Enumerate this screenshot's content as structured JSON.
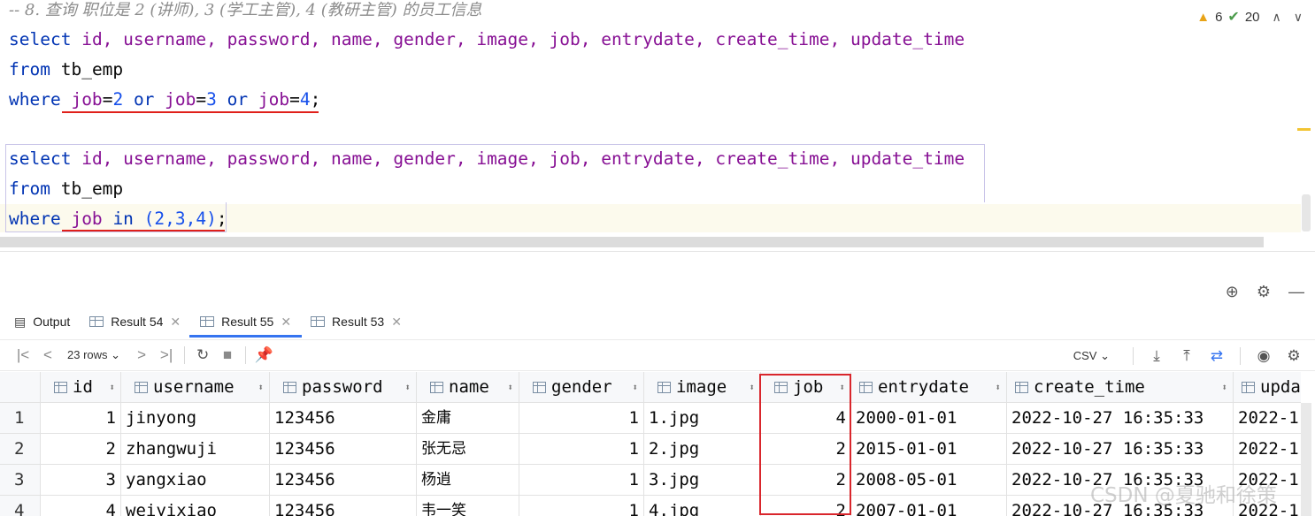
{
  "editor": {
    "comment": "-- 8. 查询 职位是 2 (讲师), 3 (学工主管), 4 (教研主管) 的员工信息",
    "query1": {
      "select_kw": "select",
      "columns": "id, username, password, name, gender, image, job, entrydate, create_time, update_time",
      "from_kw": "from",
      "table": "tb_emp",
      "where_kw": "where",
      "cond": [
        {
          "col": "job",
          "op": "=",
          "val": "2"
        },
        {
          "kw": "or"
        },
        {
          "col": "job",
          "op": "=",
          "val": "3"
        },
        {
          "kw": "or"
        },
        {
          "col": "job",
          "op": "=",
          "val": "4"
        }
      ],
      "end": ";"
    },
    "query2": {
      "select_kw": "select",
      "columns": "id, username, password, name, gender, image, job, entrydate, create_time, update_time",
      "from_kw": "from",
      "table": "tb_emp",
      "where_kw": "where",
      "in_col": "job",
      "in_kw": "in",
      "in_list": "(2,3,4)",
      "end": ";"
    },
    "inspections": {
      "warnings": "6",
      "ok": "20"
    }
  },
  "tabs": [
    {
      "label": "Output",
      "active": false
    },
    {
      "label": "Result 54",
      "active": false
    },
    {
      "label": "Result 55",
      "active": true
    },
    {
      "label": "Result 53",
      "active": false
    }
  ],
  "toolbar": {
    "rows": "23 rows",
    "export_format": "CSV"
  },
  "grid": {
    "columns": [
      "id",
      "username",
      "password",
      "name",
      "gender",
      "image",
      "job",
      "entrydate",
      "create_time",
      "upda"
    ],
    "rows": [
      {
        "num": "1",
        "id": "1",
        "username": "jinyong",
        "password": "123456",
        "name": "金庸",
        "gender": "1",
        "image": "1.jpg",
        "job": "4",
        "entrydate": "2000-01-01",
        "create_time": "2022-10-27 16:35:33",
        "update_time": "2022-1"
      },
      {
        "num": "2",
        "id": "2",
        "username": "zhangwuji",
        "password": "123456",
        "name": "张无忌",
        "gender": "1",
        "image": "2.jpg",
        "job": "2",
        "entrydate": "2015-01-01",
        "create_time": "2022-10-27 16:35:33",
        "update_time": "2022-1"
      },
      {
        "num": "3",
        "id": "3",
        "username": "yangxiao",
        "password": "123456",
        "name": "杨逍",
        "gender": "1",
        "image": "3.jpg",
        "job": "2",
        "entrydate": "2008-05-01",
        "create_time": "2022-10-27 16:35:33",
        "update_time": "2022-1"
      },
      {
        "num": "4",
        "id": "4",
        "username": "weiyixiao",
        "password": "123456",
        "name": "韦一笑",
        "gender": "1",
        "image": "4.jpg",
        "job": "2",
        "entrydate": "2007-01-01",
        "create_time": "2022-10-27 16:35:33",
        "update_time": "2022-1"
      }
    ]
  },
  "watermark": "CSDN @夏驰和徐策",
  "colors": {
    "accent": "#3574f0",
    "highlight_red": "#d9262c",
    "keyword": "#0033b3",
    "column": "#871094",
    "number": "#1750eb"
  }
}
